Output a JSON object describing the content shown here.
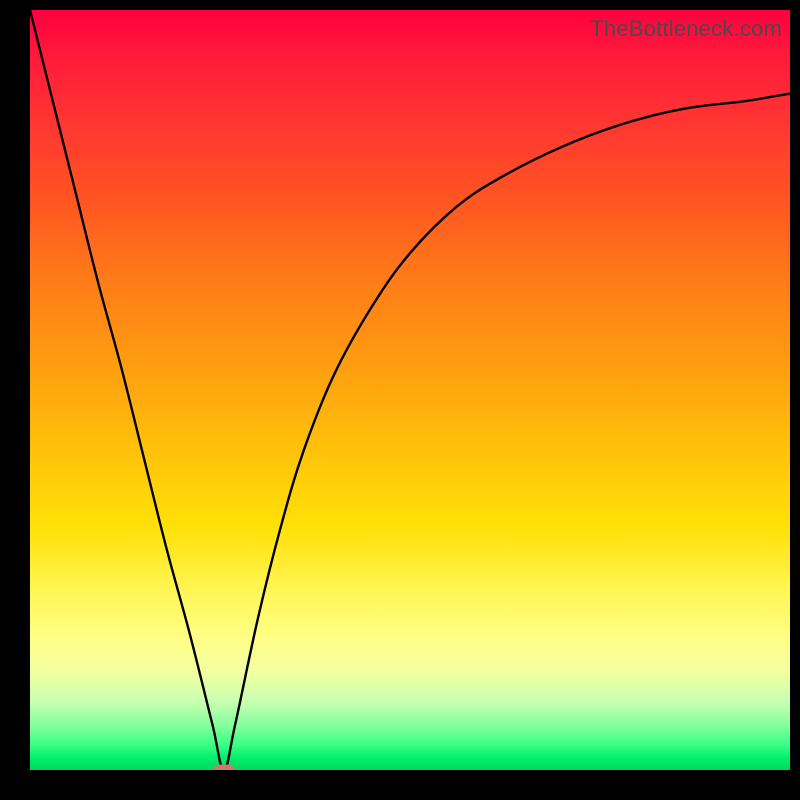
{
  "watermark": {
    "text": "TheBottleneck.com"
  },
  "chart_data": {
    "type": "line",
    "title": "",
    "xlabel": "",
    "ylabel": "",
    "xlim": [
      0,
      100
    ],
    "ylim": [
      0,
      100
    ],
    "grid": false,
    "legend": false,
    "annotations": [],
    "background_gradient": {
      "direction": "vertical",
      "stops": [
        {
          "pos": 0,
          "meaning": "high-bottleneck",
          "color": "#ff0040"
        },
        {
          "pos": 0.5,
          "meaning": "mid",
          "color": "#ffb000"
        },
        {
          "pos": 0.82,
          "meaning": "low",
          "color": "#ffff70"
        },
        {
          "pos": 1.0,
          "meaning": "optimal",
          "color": "#00d857"
        }
      ]
    },
    "series": [
      {
        "name": "bottleneck-curve",
        "color": "#000000",
        "x": [
          0,
          3,
          6,
          9,
          12,
          15,
          18,
          21,
          24,
          25.5,
          27,
          30,
          33,
          36,
          40,
          45,
          50,
          56,
          62,
          70,
          78,
          86,
          94,
          100
        ],
        "y": [
          100,
          88,
          76,
          64,
          53,
          41,
          29,
          18,
          6,
          0,
          6,
          20,
          32,
          42,
          52,
          61,
          68,
          74,
          78,
          82,
          85,
          87,
          88,
          89
        ]
      }
    ],
    "marker": {
      "x": 25.5,
      "y": 0,
      "color": "#cf7a6f",
      "shape": "pill"
    }
  }
}
